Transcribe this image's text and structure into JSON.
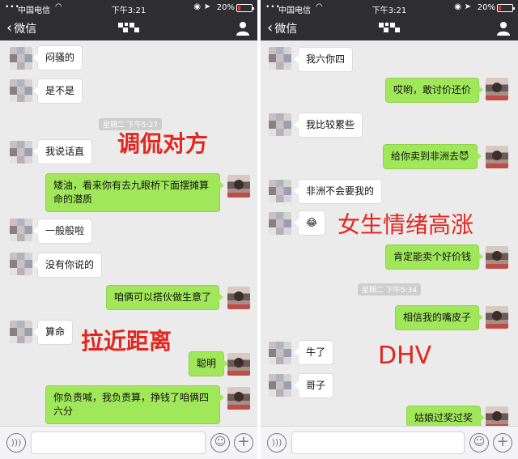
{
  "status_bar": {
    "carrier": "中国电信",
    "time": "下午3:21",
    "battery": "20%",
    "battery_level": 0.2
  },
  "nav": {
    "back_label": "微信"
  },
  "left": {
    "messages": [
      {
        "side": "in",
        "text": "闷骚的"
      },
      {
        "side": "in",
        "text": "是不是"
      },
      {
        "side": "in",
        "text": "我说话直"
      },
      {
        "side": "out",
        "text": "矮油，看来你有去九眼桥下面摆摊算命的潜质"
      },
      {
        "side": "in",
        "text": "一般般啦"
      },
      {
        "side": "in",
        "text": "没有你说的"
      },
      {
        "side": "out",
        "text": "咱俩可以搭伙做生意了"
      },
      {
        "side": "in",
        "text": "算命"
      },
      {
        "side": "out",
        "text": "聪明"
      },
      {
        "side": "out",
        "text": "你负责喊，我负责算，挣钱了咱俩四六分"
      }
    ],
    "timestamp": "星期二 下午5:27",
    "annotations": [
      "调侃对方",
      "拉近距离"
    ]
  },
  "right": {
    "messages": [
      {
        "side": "in",
        "text": "我六你四"
      },
      {
        "side": "out",
        "text": "哎哟，敢讨价还价"
      },
      {
        "side": "in",
        "text": "我比较累些"
      },
      {
        "side": "out",
        "text": "给你卖到非洲去😈"
      },
      {
        "side": "in",
        "text": "非洲不会要我的"
      },
      {
        "side": "in",
        "text": "😂"
      },
      {
        "side": "out",
        "text": "肯定能卖个好价钱"
      },
      {
        "side": "out",
        "text": "相信我的嘴皮子"
      },
      {
        "side": "in",
        "text": "牛了"
      },
      {
        "side": "in",
        "text": "哥子"
      },
      {
        "side": "out",
        "text": "姑娘过奖过奖"
      }
    ],
    "timestamp": "星期二 下午5:34",
    "annotations": [
      "女生情绪高涨",
      "DHV"
    ]
  },
  "colors": {
    "header": "#2e2e32",
    "chat_bg": "#ebebeb",
    "bubble_out": "#a0e759",
    "bubble_in": "#ffffff",
    "annotation": "#e3261f"
  }
}
